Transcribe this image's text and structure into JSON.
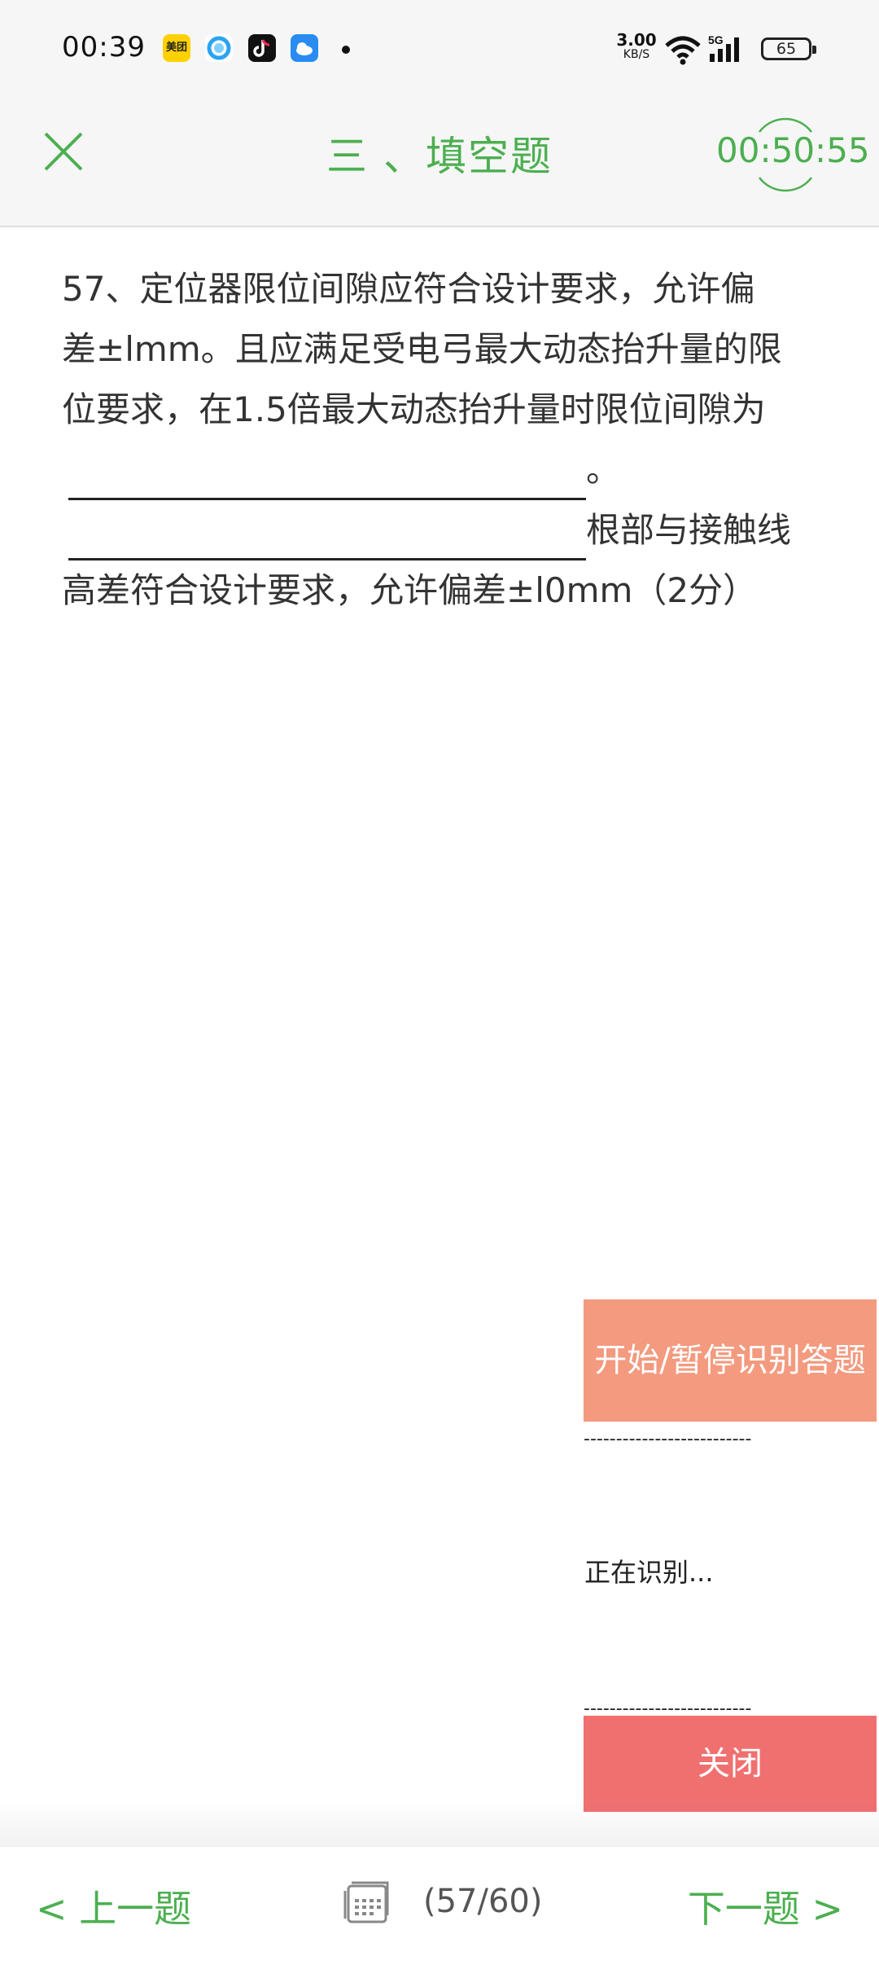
{
  "status_bar": {
    "time": "00:39",
    "apps": [
      "meituan-icon",
      "browser-icon",
      "tiktok-icon",
      "weather-icon"
    ],
    "meituan_label": "美团",
    "net_speed_value": "3.00",
    "net_speed_unit": "KB/S",
    "network": "5G",
    "battery": "65"
  },
  "header": {
    "title": "三 、填空题",
    "timer": "00:50:55",
    "accent_color": "#4caf50"
  },
  "question": {
    "line1": "57、定位器限位间隙应符合设计要求，允许偏",
    "line2": "差±lmm。且应满足受电弓最大动态抬升量的限",
    "line3": "位要求，在1.5倍最大动态抬升量时限位间隙为",
    "after_blank1": "。",
    "after_blank2": "根部与接触线",
    "line6": "高差符合设计要求，允许偏差±l0mm（2分）"
  },
  "recognition_panel": {
    "start_label": "开始/暂停识别答题",
    "divider": "--------------------------",
    "status": "正在识别...",
    "close_label": "关闭",
    "start_color": "#f39a7f",
    "close_color": "#f07070"
  },
  "bottom_nav": {
    "prev_label": "< 上一题",
    "next_label": "下一题 >",
    "progress": "(57/60)"
  }
}
